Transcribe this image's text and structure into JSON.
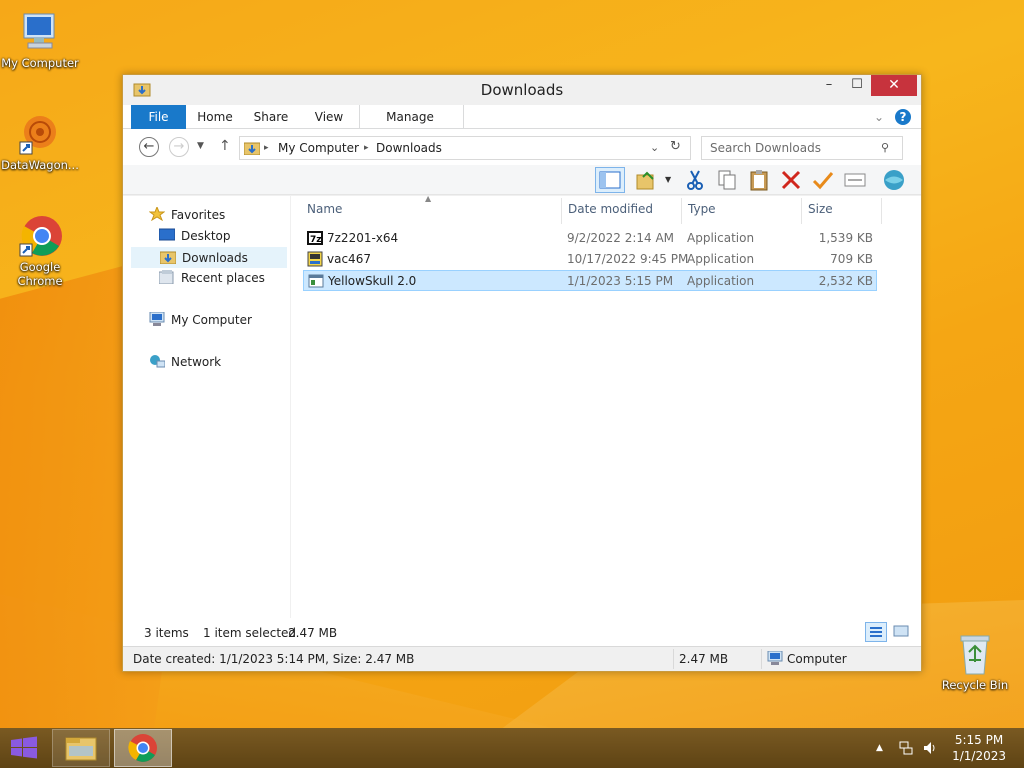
{
  "desktop": {
    "icons": [
      {
        "label": "My Computer"
      },
      {
        "label": "DataWagon..."
      },
      {
        "label": "Google Chrome"
      },
      {
        "label": "Recycle Bin"
      }
    ]
  },
  "window": {
    "title": "Downloads",
    "controls": {
      "minimize": "–",
      "maximize": "☐",
      "close": "✕"
    },
    "ribbon_tabs": [
      "File",
      "Home",
      "Share",
      "View",
      "Manage"
    ],
    "help": "?",
    "address": {
      "parts": [
        "My Computer",
        "Downloads"
      ]
    },
    "search": {
      "placeholder": "Search Downloads"
    },
    "nav_pane": {
      "favorites": "Favorites",
      "desktop": "Desktop",
      "downloads": "Downloads",
      "recent": "Recent places",
      "computer": "My Computer",
      "network": "Network"
    },
    "columns": [
      "Name",
      "Date modified",
      "Type",
      "Size"
    ],
    "files": [
      {
        "name": "7z2201-x64",
        "date": "9/2/2022 2:14 AM",
        "type": "Application",
        "size": "1,539 KB",
        "selected": false
      },
      {
        "name": "vac467",
        "date": "10/17/2022 9:45 PM",
        "type": "Application",
        "size": "709 KB",
        "selected": false
      },
      {
        "name": "YellowSkull 2.0",
        "date": "1/1/2023 5:15 PM",
        "type": "Application",
        "size": "2,532 KB",
        "selected": true
      }
    ],
    "status": {
      "items": "3 items",
      "selection": "1 item selected",
      "selection_size": "2.47 MB"
    },
    "details": {
      "info": "Date created: 1/1/2023 5:14 PM, Size: 2.47 MB",
      "size": "2.47 MB",
      "location": "Computer"
    }
  },
  "taskbar": {
    "time": "5:15 PM",
    "date": "1/1/2023"
  },
  "colors": {
    "accent": "#1979ca",
    "selection": "#cce8ff",
    "close": "#c7333d"
  }
}
